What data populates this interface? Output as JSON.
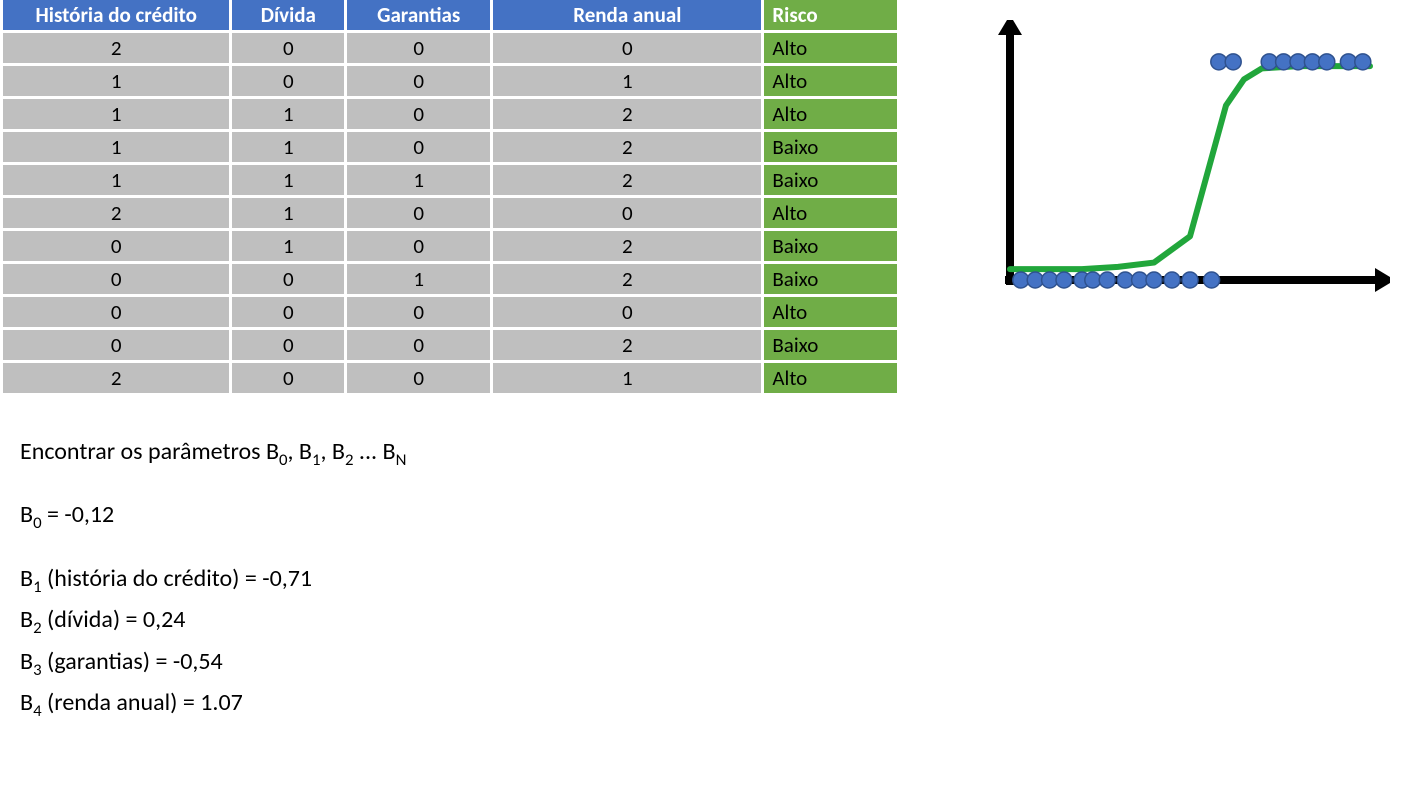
{
  "table": {
    "headers": [
      "História do crédito",
      "Dívida",
      "Garantias",
      "Renda anual",
      "Risco"
    ],
    "rows": [
      {
        "c": [
          "2",
          "0",
          "0",
          "0"
        ],
        "r": "Alto"
      },
      {
        "c": [
          "1",
          "0",
          "0",
          "1"
        ],
        "r": "Alto"
      },
      {
        "c": [
          "1",
          "1",
          "0",
          "2"
        ],
        "r": "Alto"
      },
      {
        "c": [
          "1",
          "1",
          "0",
          "2"
        ],
        "r": "Baixo"
      },
      {
        "c": [
          "1",
          "1",
          "1",
          "2"
        ],
        "r": "Baixo"
      },
      {
        "c": [
          "2",
          "1",
          "0",
          "0"
        ],
        "r": "Alto"
      },
      {
        "c": [
          "0",
          "1",
          "0",
          "2"
        ],
        "r": "Baixo"
      },
      {
        "c": [
          "0",
          "0",
          "1",
          "2"
        ],
        "r": "Baixo"
      },
      {
        "c": [
          "0",
          "0",
          "0",
          "0"
        ],
        "r": "Alto"
      },
      {
        "c": [
          "0",
          "0",
          "0",
          "2"
        ],
        "r": "Baixo"
      },
      {
        "c": [
          "2",
          "0",
          "0",
          "1"
        ],
        "r": "Alto"
      }
    ]
  },
  "text": {
    "find_params": "Encontrar os parâmetros B",
    "find_params_tail": " ... B",
    "b0": " = -0,12",
    "b1": " (história do crédito) = -0,71",
    "b2": " (dívida) = 0,24",
    "b3": " (garantias) = -0,54",
    "b4": " (renda anual) = 1.07"
  },
  "chart_data": {
    "type": "scatter",
    "title": "",
    "xlabel": "",
    "ylabel": "",
    "xlim": [
      0,
      10
    ],
    "ylim": [
      0,
      1.1
    ],
    "series": [
      {
        "name": "sigmoid-curve",
        "type": "line",
        "x": [
          0,
          1,
          2,
          3,
          4,
          5,
          5.5,
          6,
          6.5,
          7,
          8,
          9,
          10
        ],
        "y": [
          0.05,
          0.05,
          0.05,
          0.06,
          0.08,
          0.2,
          0.5,
          0.8,
          0.92,
          0.97,
          0.98,
          0.98,
          0.98
        ]
      },
      {
        "name": "points-low",
        "type": "scatter",
        "x": [
          0.3,
          0.7,
          1.1,
          1.5,
          2.0,
          2.3,
          2.7,
          3.2,
          3.6,
          4.0,
          4.5,
          5.0,
          5.6
        ],
        "y": [
          0,
          0,
          0,
          0,
          0,
          0,
          0,
          0,
          0,
          0,
          0,
          0,
          0
        ]
      },
      {
        "name": "points-high",
        "type": "scatter",
        "x": [
          5.8,
          6.2,
          7.2,
          7.6,
          8.0,
          8.4,
          8.8,
          9.4,
          9.8
        ],
        "y": [
          1,
          1,
          1,
          1,
          1,
          1,
          1,
          1,
          1
        ]
      }
    ]
  }
}
